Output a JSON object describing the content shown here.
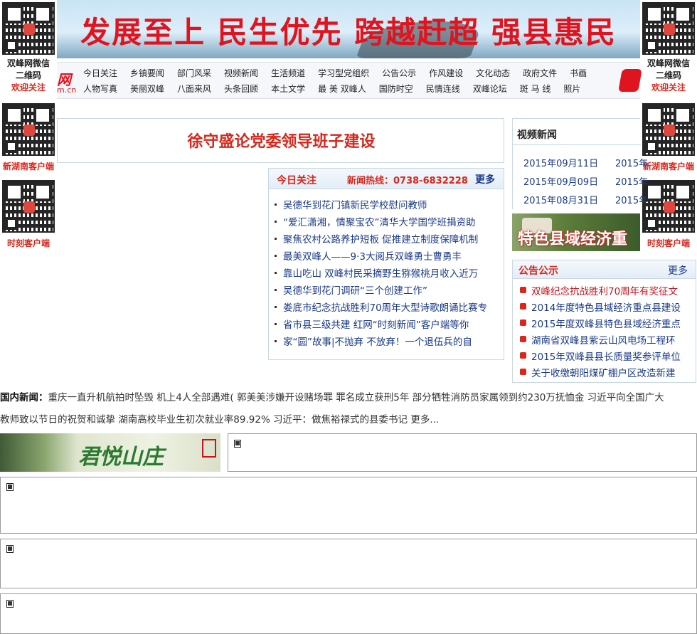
{
  "side_left": {
    "wechat_caption_1": "双峰网微信",
    "wechat_caption_2": "二维码",
    "wechat_caption_3": "欢迎关注",
    "xhn_caption": "新湖南客户端",
    "sk_caption": "时刻客户端"
  },
  "side_right": {
    "wechat_caption_1": "双峰网微信",
    "wechat_caption_2": "二维码",
    "wechat_caption_3": "欢迎关注",
    "xhn_caption": "新湖南客户端",
    "sk_caption": "时刻客户端"
  },
  "banner": {
    "slogan": "发展至上 民生优先 跨越赶超 强县惠民"
  },
  "nav": {
    "logo": "网",
    "logo_sub": "m.cn",
    "row1": [
      "今日关注",
      "乡镇要闻",
      "部门风采",
      "视频新闻",
      "生活频道",
      "学习型党组织",
      "公告公示",
      "作风建设",
      "文化动态",
      "政府文件",
      "书画"
    ],
    "row2": [
      "人物写真",
      "美丽双峰",
      "八面来风",
      "头条回顾",
      "本土文学",
      "最 美 双峰人",
      "国防时空",
      "民情连线",
      "双峰论坛",
      "斑 马 线",
      "照片"
    ]
  },
  "headline": "徐守盛论党委领导班子建设",
  "today": {
    "title": "今日关注",
    "hotline": "新闻热线：0738-6832228",
    "more": "更多",
    "items": [
      "吴德华到花门镇新民学校慰问教师",
      "“爱汇潇湘，情聚宝农”清华大学国学班捐资助",
      "聚焦农村公路养护短板 促推建立制度保障机制",
      "最美双峰人——9·3大阅兵双峰勇士曹勇丰",
      "靠山吃山 双峰村民采摘野生猕猴桃月收入近万",
      "吴德华到花门调研“三个创建工作”",
      "娄底市纪念抗战胜利70周年大型诗歌朗诵比赛专",
      "省市县三级共建 红网“时刻新闻”客户端等你",
      "家“圆”故事|不抛弃 不放弃！一个退伍兵的自"
    ]
  },
  "video": {
    "title": "视频新闻",
    "dates_left": [
      "2015年09月11日",
      "2015年09月09日",
      "2015年08月31日"
    ],
    "dates_right": [
      "2015年",
      "2015年",
      "2015年"
    ]
  },
  "county_banner": "特色县域经济重",
  "notice": {
    "title": "公告公示",
    "more": "更多",
    "items": [
      "双峰纪念抗战胜利70周年有奖征文",
      "2014年度特色县域经济重点县建设",
      "2015年度双峰县特色县域经济重点",
      "湖南省双峰县紫云山风电场工程环",
      "2015年双峰县县长质量奖参评单位",
      "关于收缴朝阳煤矿棚户区改造新建"
    ]
  },
  "domestic": {
    "label": "国内新闻：",
    "line1": "重庆一直升机航拍时坠毁 机上4人全部遇难( 郭美美涉嫌开设赌场罪 罪名成立获刑5年 部分牺牲消防员家属领到约230万抚恤金 习近平向全国广大",
    "line2": "教师致以节日的祝贺和诚挚 湖南高校毕业生初次就业率89.92% 习近平：做焦裕禄式的县委书记 更多..."
  },
  "junyue": "君悦山庄",
  "colors": {
    "accent_red": "#d8271c",
    "link_blue": "#1a3a8a",
    "border_blue": "#c8d7e6"
  }
}
